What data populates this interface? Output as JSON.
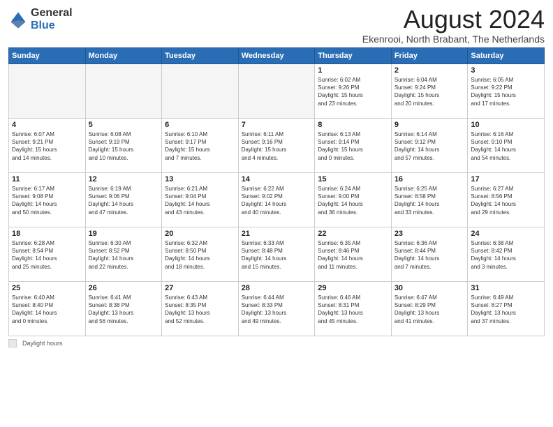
{
  "header": {
    "logo_general": "General",
    "logo_blue": "Blue",
    "month_title": "August 2024",
    "location": "Ekenrooi, North Brabant, The Netherlands"
  },
  "footer": {
    "label": "Daylight hours"
  },
  "weekdays": [
    "Sunday",
    "Monday",
    "Tuesday",
    "Wednesday",
    "Thursday",
    "Friday",
    "Saturday"
  ],
  "weeks": [
    [
      {
        "day": "",
        "info": "",
        "empty": true
      },
      {
        "day": "",
        "info": "",
        "empty": true
      },
      {
        "day": "",
        "info": "",
        "empty": true
      },
      {
        "day": "",
        "info": "",
        "empty": true
      },
      {
        "day": "1",
        "info": "Sunrise: 6:02 AM\nSunset: 9:26 PM\nDaylight: 15 hours\nand 23 minutes.",
        "empty": false
      },
      {
        "day": "2",
        "info": "Sunrise: 6:04 AM\nSunset: 9:24 PM\nDaylight: 15 hours\nand 20 minutes.",
        "empty": false
      },
      {
        "day": "3",
        "info": "Sunrise: 6:05 AM\nSunset: 9:22 PM\nDaylight: 15 hours\nand 17 minutes.",
        "empty": false
      }
    ],
    [
      {
        "day": "4",
        "info": "Sunrise: 6:07 AM\nSunset: 9:21 PM\nDaylight: 15 hours\nand 14 minutes.",
        "empty": false
      },
      {
        "day": "5",
        "info": "Sunrise: 6:08 AM\nSunset: 9:19 PM\nDaylight: 15 hours\nand 10 minutes.",
        "empty": false
      },
      {
        "day": "6",
        "info": "Sunrise: 6:10 AM\nSunset: 9:17 PM\nDaylight: 15 hours\nand 7 minutes.",
        "empty": false
      },
      {
        "day": "7",
        "info": "Sunrise: 6:11 AM\nSunset: 9:16 PM\nDaylight: 15 hours\nand 4 minutes.",
        "empty": false
      },
      {
        "day": "8",
        "info": "Sunrise: 6:13 AM\nSunset: 9:14 PM\nDaylight: 15 hours\nand 0 minutes.",
        "empty": false
      },
      {
        "day": "9",
        "info": "Sunrise: 6:14 AM\nSunset: 9:12 PM\nDaylight: 14 hours\nand 57 minutes.",
        "empty": false
      },
      {
        "day": "10",
        "info": "Sunrise: 6:16 AM\nSunset: 9:10 PM\nDaylight: 14 hours\nand 54 minutes.",
        "empty": false
      }
    ],
    [
      {
        "day": "11",
        "info": "Sunrise: 6:17 AM\nSunset: 9:08 PM\nDaylight: 14 hours\nand 50 minutes.",
        "empty": false
      },
      {
        "day": "12",
        "info": "Sunrise: 6:19 AM\nSunset: 9:06 PM\nDaylight: 14 hours\nand 47 minutes.",
        "empty": false
      },
      {
        "day": "13",
        "info": "Sunrise: 6:21 AM\nSunset: 9:04 PM\nDaylight: 14 hours\nand 43 minutes.",
        "empty": false
      },
      {
        "day": "14",
        "info": "Sunrise: 6:22 AM\nSunset: 9:02 PM\nDaylight: 14 hours\nand 40 minutes.",
        "empty": false
      },
      {
        "day": "15",
        "info": "Sunrise: 6:24 AM\nSunset: 9:00 PM\nDaylight: 14 hours\nand 36 minutes.",
        "empty": false
      },
      {
        "day": "16",
        "info": "Sunrise: 6:25 AM\nSunset: 8:58 PM\nDaylight: 14 hours\nand 33 minutes.",
        "empty": false
      },
      {
        "day": "17",
        "info": "Sunrise: 6:27 AM\nSunset: 8:56 PM\nDaylight: 14 hours\nand 29 minutes.",
        "empty": false
      }
    ],
    [
      {
        "day": "18",
        "info": "Sunrise: 6:28 AM\nSunset: 8:54 PM\nDaylight: 14 hours\nand 25 minutes.",
        "empty": false
      },
      {
        "day": "19",
        "info": "Sunrise: 6:30 AM\nSunset: 8:52 PM\nDaylight: 14 hours\nand 22 minutes.",
        "empty": false
      },
      {
        "day": "20",
        "info": "Sunrise: 6:32 AM\nSunset: 8:50 PM\nDaylight: 14 hours\nand 18 minutes.",
        "empty": false
      },
      {
        "day": "21",
        "info": "Sunrise: 6:33 AM\nSunset: 8:48 PM\nDaylight: 14 hours\nand 15 minutes.",
        "empty": false
      },
      {
        "day": "22",
        "info": "Sunrise: 6:35 AM\nSunset: 8:46 PM\nDaylight: 14 hours\nand 11 minutes.",
        "empty": false
      },
      {
        "day": "23",
        "info": "Sunrise: 6:36 AM\nSunset: 8:44 PM\nDaylight: 14 hours\nand 7 minutes.",
        "empty": false
      },
      {
        "day": "24",
        "info": "Sunrise: 6:38 AM\nSunset: 8:42 PM\nDaylight: 14 hours\nand 3 minutes.",
        "empty": false
      }
    ],
    [
      {
        "day": "25",
        "info": "Sunrise: 6:40 AM\nSunset: 8:40 PM\nDaylight: 14 hours\nand 0 minutes.",
        "empty": false
      },
      {
        "day": "26",
        "info": "Sunrise: 6:41 AM\nSunset: 8:38 PM\nDaylight: 13 hours\nand 56 minutes.",
        "empty": false
      },
      {
        "day": "27",
        "info": "Sunrise: 6:43 AM\nSunset: 8:35 PM\nDaylight: 13 hours\nand 52 minutes.",
        "empty": false
      },
      {
        "day": "28",
        "info": "Sunrise: 6:44 AM\nSunset: 8:33 PM\nDaylight: 13 hours\nand 49 minutes.",
        "empty": false
      },
      {
        "day": "29",
        "info": "Sunrise: 6:46 AM\nSunset: 8:31 PM\nDaylight: 13 hours\nand 45 minutes.",
        "empty": false
      },
      {
        "day": "30",
        "info": "Sunrise: 6:47 AM\nSunset: 8:29 PM\nDaylight: 13 hours\nand 41 minutes.",
        "empty": false
      },
      {
        "day": "31",
        "info": "Sunrise: 6:49 AM\nSunset: 8:27 PM\nDaylight: 13 hours\nand 37 minutes.",
        "empty": false
      }
    ]
  ]
}
